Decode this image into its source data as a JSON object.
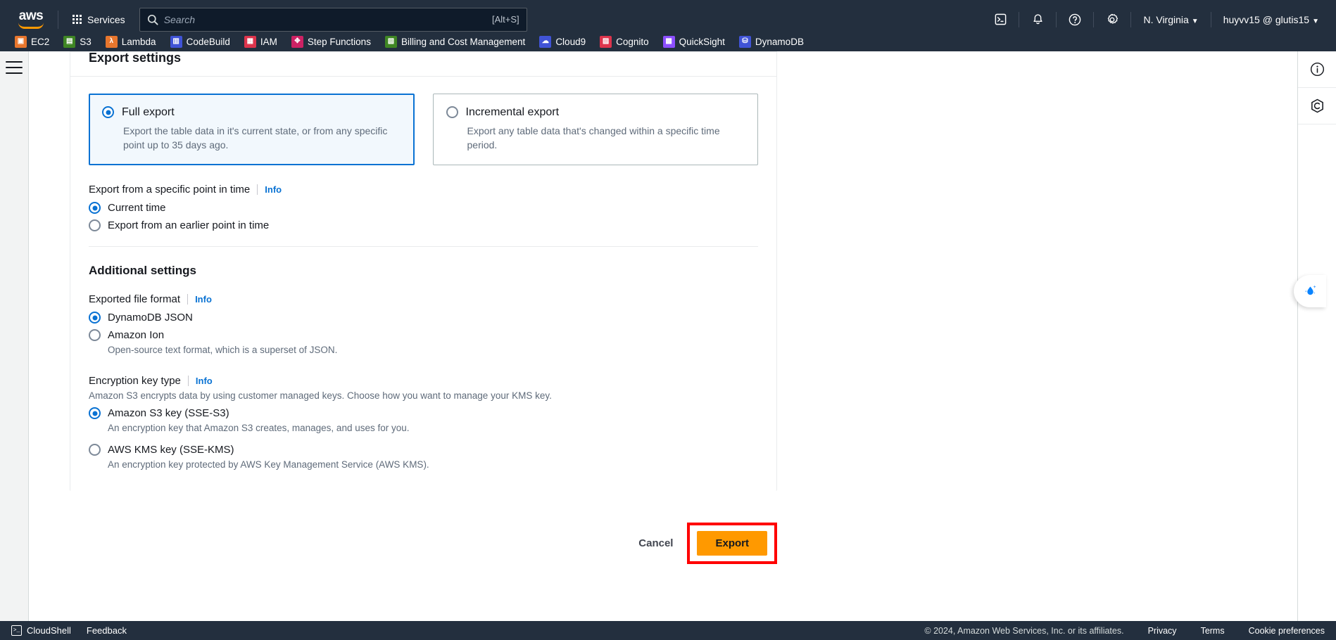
{
  "topnav": {
    "logo_text": "aws",
    "services_label": "Services",
    "search": {
      "placeholder": "Search",
      "value": "",
      "shortcut_hint": "[Alt+S]",
      "icon": "search-icon"
    },
    "icons": [
      {
        "name": "cloudshell-icon",
        "glyph": "cloudshell"
      },
      {
        "name": "notifications-bell-icon",
        "glyph": "bell"
      },
      {
        "name": "help-question-icon",
        "glyph": "question"
      },
      {
        "name": "settings-gear-icon",
        "glyph": "gear"
      }
    ],
    "region": "N. Virginia",
    "account": "huyvv15 @ glutis15",
    "caret": "▼"
  },
  "favorites": [
    {
      "label": "EC2",
      "color": "#e8762d",
      "abbr": "EC2"
    },
    {
      "label": "S3",
      "color": "#3f8624",
      "abbr": "S3"
    },
    {
      "label": "Lambda",
      "color": "#e8762d",
      "abbr": "λ"
    },
    {
      "label": "CodeBuild",
      "color": "#4053d6",
      "abbr": "CB"
    },
    {
      "label": "IAM",
      "color": "#dd344c",
      "abbr": "IAM"
    },
    {
      "label": "Step Functions",
      "color": "#cd2264",
      "abbr": "SF"
    },
    {
      "label": "Billing and Cost Management",
      "color": "#3f8624",
      "abbr": "B"
    },
    {
      "label": "Cloud9",
      "color": "#4053d6",
      "abbr": "C9"
    },
    {
      "label": "Cognito",
      "color": "#dd344c",
      "abbr": "CG"
    },
    {
      "label": "QuickSight",
      "color": "#8c4fff",
      "abbr": "QS"
    },
    {
      "label": "DynamoDB",
      "color": "#4053d6",
      "abbr": "DB"
    }
  ],
  "left_rail": {
    "menu_icon": "hamburger-menu-icon"
  },
  "form": {
    "title": "Export settings",
    "export_type_tiles": [
      {
        "title": "Full export",
        "description": "Export the table data in it's current state, or from any specific point up to 35 days ago.",
        "selected": true
      },
      {
        "title": "Incremental export",
        "description": "Export any table data that's changed within a specific time period.",
        "selected": false
      }
    ],
    "point_in_time": {
      "label": "Export from a specific point in time",
      "info": "Info",
      "options": [
        {
          "label": "Current time",
          "selected": true
        },
        {
          "label": "Export from an earlier point in time",
          "selected": false
        }
      ]
    },
    "additional_settings": {
      "title": "Additional settings",
      "file_format": {
        "label": "Exported file format",
        "info": "Info",
        "options": [
          {
            "label": "DynamoDB JSON",
            "description": "",
            "selected": true
          },
          {
            "label": "Amazon Ion",
            "description": "Open-source text format, which is a superset of JSON.",
            "selected": false
          }
        ]
      },
      "encryption": {
        "label": "Encryption key type",
        "info": "Info",
        "helper": "Amazon S3 encrypts data by using customer managed keys. Choose how you want to manage your KMS key.",
        "options": [
          {
            "label": "Amazon S3 key (SSE-S3)",
            "description": "An encryption key that Amazon S3 creates, manages, and uses for you.",
            "selected": true
          },
          {
            "label": "AWS KMS key (SSE-KMS)",
            "description": "An encryption key protected by AWS Key Management Service (AWS KMS).",
            "selected": false
          }
        ]
      }
    },
    "actions": {
      "cancel_label": "Cancel",
      "export_label": "Export",
      "export_highlight_color": "#ff0000",
      "export_button_color": "#ff9900"
    }
  },
  "right_panel": {
    "buttons": [
      {
        "name": "info-panel-icon",
        "title": "Info"
      },
      {
        "name": "shield-security-icon",
        "title": "Security"
      }
    ],
    "assistant": {
      "name": "q-assistant-icon",
      "title": "Amazon Q"
    }
  },
  "statusbar": {
    "cloudshell": "CloudShell",
    "feedback": "Feedback",
    "copyright": "© 2024, Amazon Web Services, Inc. or its affiliates.",
    "links": [
      "Privacy",
      "Terms",
      "Cookie preferences"
    ]
  },
  "colors": {
    "nav_bg": "#232f3e",
    "accent_blue": "#0972d3",
    "accent_orange": "#ff9900",
    "highlight_red": "#ff0000"
  }
}
